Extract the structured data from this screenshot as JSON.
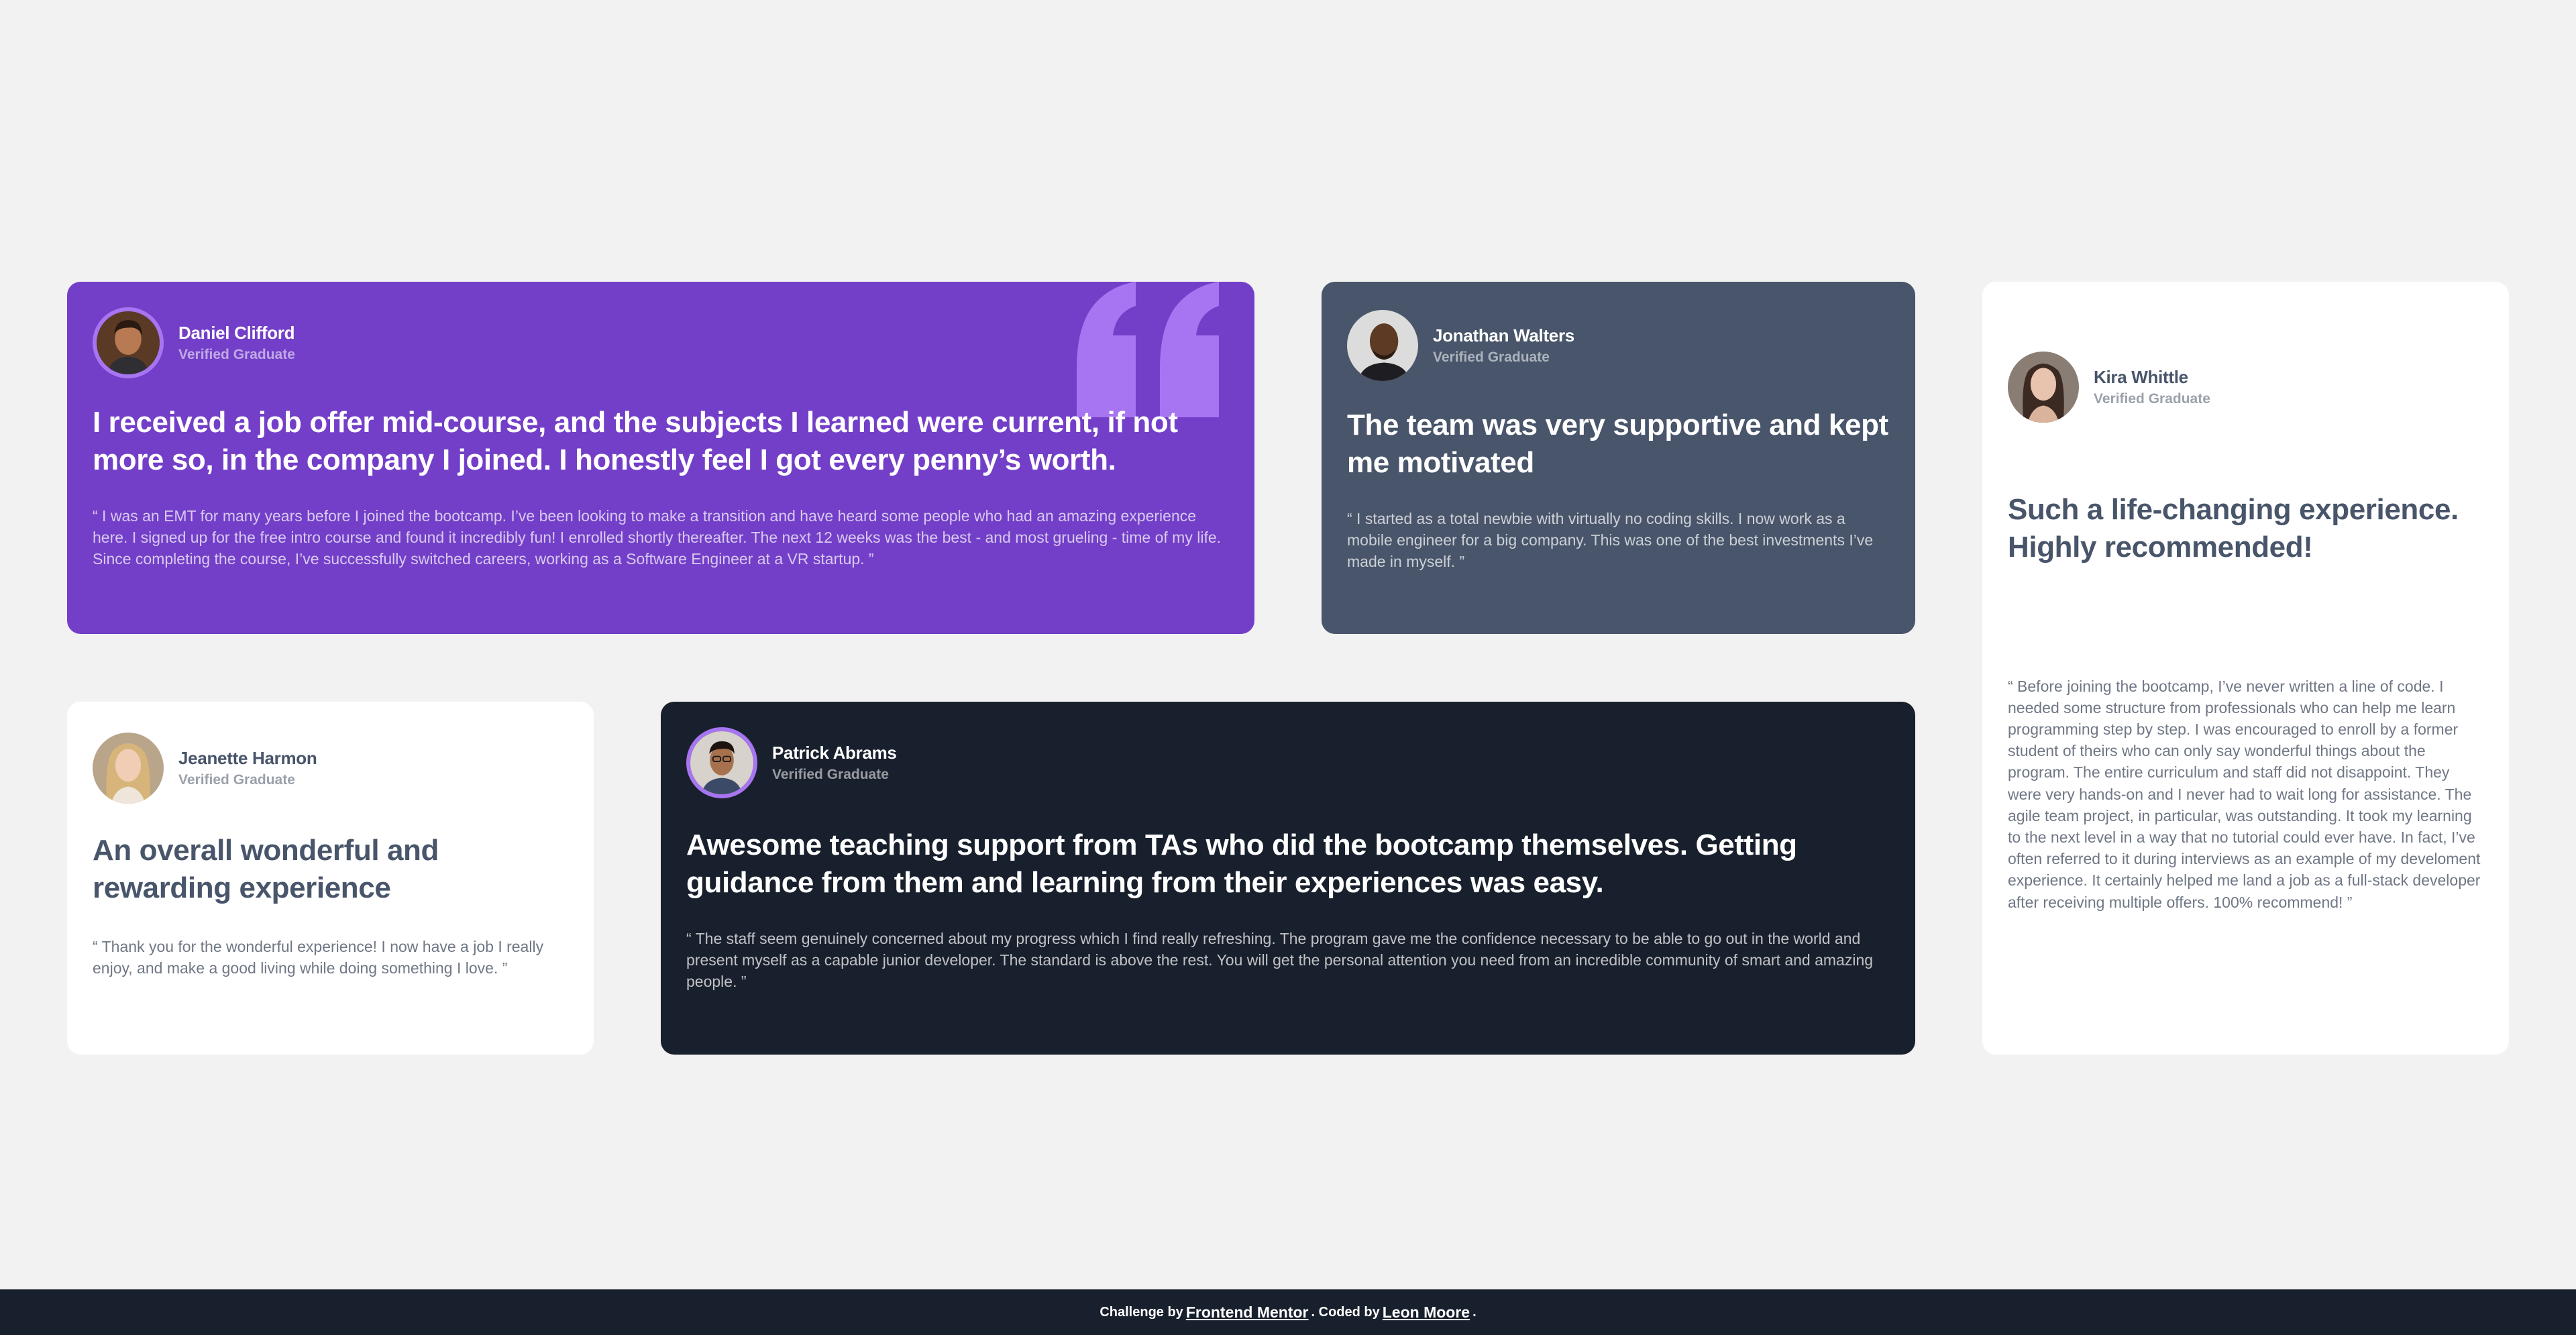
{
  "colors": {
    "page_bg": "#f2f2f2",
    "purple": "#733fc8",
    "purple_accent": "#a775f1",
    "grayish_blue": "#48556a",
    "dark_blue": "#19202d",
    "white": "#ffffff"
  },
  "testimonials": [
    {
      "name": "Daniel Clifford",
      "role": "Verified Graduate",
      "headline": "I received a job offer mid-course, and the subjects I learned were current, if not more so, in the company I joined. I honestly feel I got every penny’s worth.",
      "quote": "“ I was an EMT for many years before I joined the bootcamp. I’ve been looking to make a transition and have heard some people who had an amazing experience here. I signed up for the free intro course and found it incredibly fun! I enrolled shortly thereafter. The next 12 weeks was the best - and most grueling - time of my life. Since completing the course, I’ve successfully switched careers, working as a Software Engineer at a VR startup. ”",
      "avatar_icon": "avatar-daniel-icon",
      "decor_icon": "quotation-mark-icon"
    },
    {
      "name": "Jonathan Walters",
      "role": "Verified Graduate",
      "headline": "The team was very supportive and kept me motivated",
      "quote": "“ I started as a total newbie with virtually no coding skills. I now work as a mobile engineer for a big company. This was one of the best investments I’ve made in myself. ”",
      "avatar_icon": "avatar-jonathan-icon"
    },
    {
      "name": "Kira Whittle",
      "role": "Verified Graduate",
      "headline": "Such a life-changing experience. Highly recommended!",
      "quote": "“ Before joining the bootcamp, I’ve never written a line of code. I needed some structure from professionals who can help me learn programming step by step. I was encouraged to enroll by a former student of theirs who can only say wonderful things about the program. The entire curriculum and staff did not disappoint. They were very hands-on and I never had to wait long for assistance. The agile team project, in particular, was outstanding. It took my learning to the next level in a way that no tutorial could ever have. In fact, I’ve often referred to it during interviews as an example of my develoment experience. It certainly helped me land a job as a full-stack developer after receiving multiple offers. 100% recommend! ”",
      "avatar_icon": "avatar-kira-icon"
    },
    {
      "name": "Jeanette Harmon",
      "role": "Verified Graduate",
      "headline": "An overall wonderful and rewarding experience",
      "quote": "“ Thank you for the wonderful experience! I now have a job I really enjoy, and make a good living while doing something I love. ”",
      "avatar_icon": "avatar-jeanette-icon"
    },
    {
      "name": "Patrick Abrams",
      "role": "Verified Graduate",
      "headline": "Awesome teaching support from TAs who did the bootcamp themselves. Getting guidance from them and learning from their experiences was easy.",
      "quote": "“ The staff seem genuinely concerned about my progress which I find really refreshing. The program gave me the confidence necessary to be able to go out in the world and present myself as a capable junior developer. The standard is above the rest. You will get the personal attention you need from an incredible community of smart and amazing people. ”",
      "avatar_icon": "avatar-patrick-icon"
    }
  ],
  "footer": {
    "prefix": "Challenge by",
    "link1": "Frontend Mentor",
    "middle": ". Coded by",
    "link2": "Leon Moore",
    "suffix": "."
  }
}
